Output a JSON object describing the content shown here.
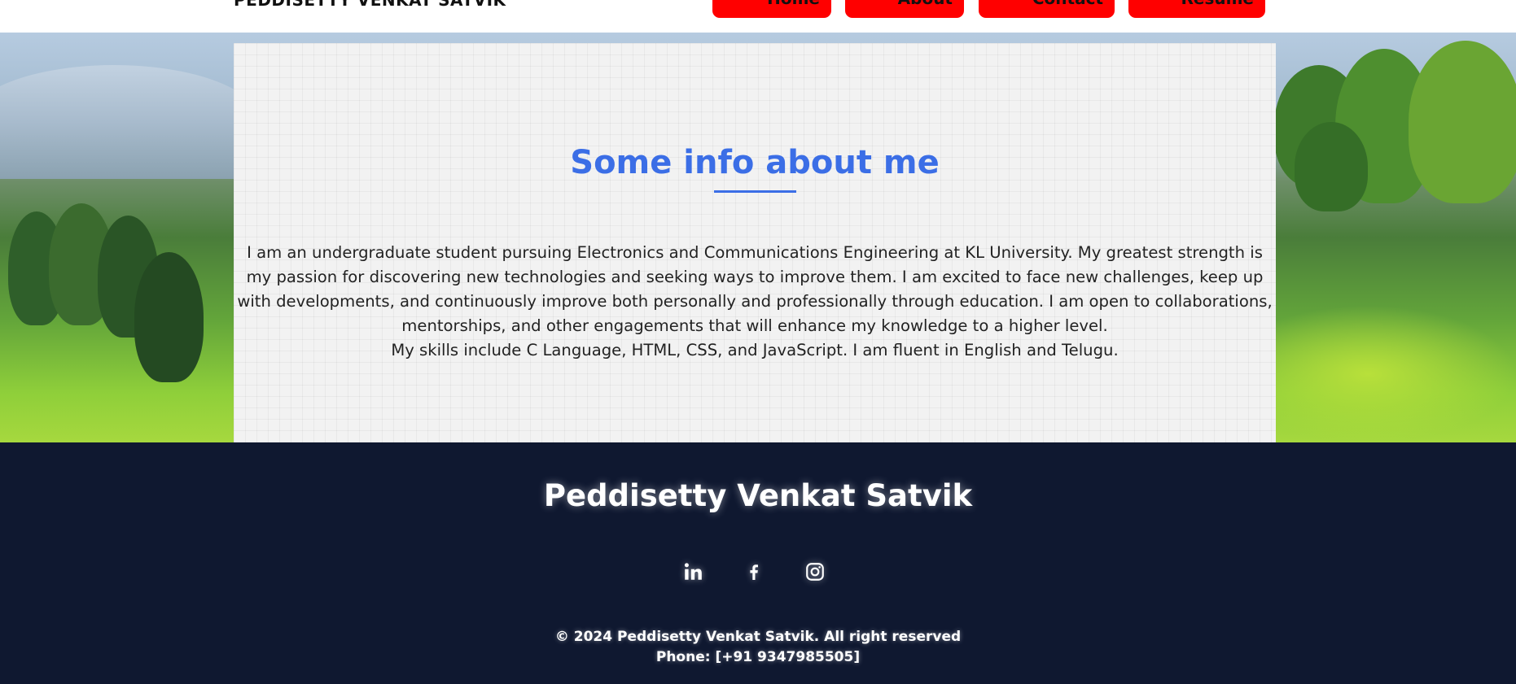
{
  "header": {
    "brand": "PEDDISETTY VENKAT SATVIK",
    "nav": {
      "home": "Home",
      "about": "About",
      "contact": "Contact",
      "resume": "Resume"
    }
  },
  "about": {
    "title": "Some info about me",
    "paragraph_1": "I am an undergraduate student pursuing Electronics and Communications Engineering at KL University. My greatest strength is my passion for discovering new technologies and seeking ways to improve them. I am excited to face new challenges, keep up with developments, and continuously improve both personally and professionally through education. I am open to collaborations, mentorships, and other engagements that will enhance my knowledge to a higher level.",
    "paragraph_2": "My skills include C Language, HTML, CSS, and JavaScript. I am fluent in English and Telugu."
  },
  "footer": {
    "name": "Peddisetty Venkat Satvik",
    "social_icons": [
      "linkedin-icon",
      "facebook-icon",
      "instagram-icon"
    ],
    "copyright": "© 2024 Peddisetty Venkat Satvik. All right reserved",
    "phone": "Phone: [+91 9347985505]"
  },
  "colors": {
    "accent": "#3b6ee6",
    "nav_button": "#ff0000",
    "footer_bg": "#0f1830",
    "card_bg": "#f2f2f2"
  }
}
